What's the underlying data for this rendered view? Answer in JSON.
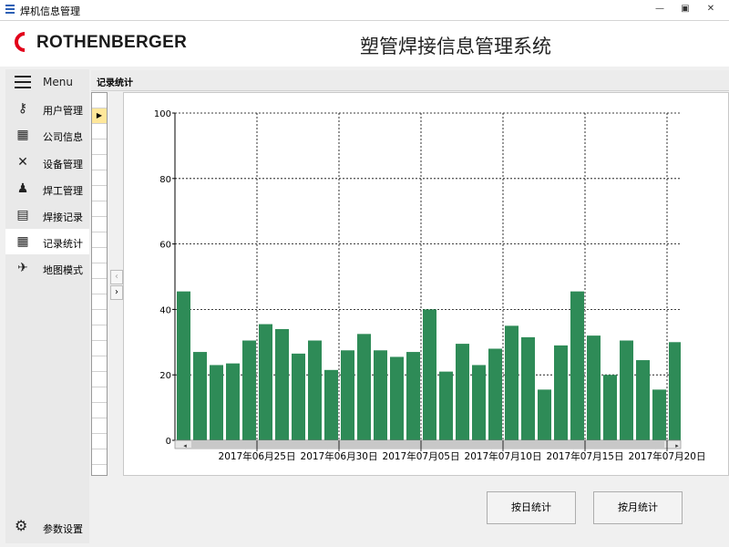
{
  "window": {
    "title": "焊机信息管理"
  },
  "header": {
    "logo_text": "ROTHENBERGER",
    "app_title": "塑管焊接信息管理系统"
  },
  "sidebar": {
    "menu_label": "Menu",
    "items": [
      {
        "label": "用户管理",
        "icon": "key-icon"
      },
      {
        "label": "公司信息",
        "icon": "building-icon"
      },
      {
        "label": "设备管理",
        "icon": "tools-icon"
      },
      {
        "label": "焊工管理",
        "icon": "person-icon"
      },
      {
        "label": "焊接记录",
        "icon": "document-icon"
      },
      {
        "label": "记录统计",
        "icon": "table-icon",
        "active": true
      },
      {
        "label": "地图模式",
        "icon": "plane-icon"
      }
    ],
    "settings_label": "参数设置"
  },
  "panel": {
    "tab_label": "记录统计"
  },
  "buttons": {
    "daily": "按日统计",
    "monthly": "按月统计"
  },
  "colors": {
    "bar": "#2e8b57",
    "logo_red": "#e2001a"
  },
  "chart_data": {
    "type": "bar",
    "title": "",
    "xlabel": "",
    "ylabel": "",
    "ylim": [
      0,
      100
    ],
    "yticks": [
      0,
      20,
      40,
      60,
      80,
      100
    ],
    "grid": true,
    "x_tick_labels": [
      "2017年06月25日",
      "2017年06月30日",
      "2017年07月05日",
      "2017年07月10日",
      "2017年07月15日",
      "2017年07月20日"
    ],
    "categories": [
      "2017-06-21",
      "2017-06-22",
      "2017-06-23",
      "2017-06-24",
      "2017-06-25",
      "2017-06-26",
      "2017-06-27",
      "2017-06-28",
      "2017-06-29",
      "2017-06-30",
      "2017-07-01",
      "2017-07-02",
      "2017-07-03",
      "2017-07-04",
      "2017-07-05",
      "2017-07-06",
      "2017-07-07",
      "2017-07-08",
      "2017-07-09",
      "2017-07-10",
      "2017-07-11",
      "2017-07-12",
      "2017-07-13",
      "2017-07-14",
      "2017-07-15",
      "2017-07-16",
      "2017-07-17",
      "2017-07-18",
      "2017-07-19",
      "2017-07-20",
      "2017-07-21"
    ],
    "values": [
      45.5,
      27,
      23,
      23.5,
      30.5,
      35.5,
      34,
      26.5,
      30.5,
      21.5,
      27.5,
      32.5,
      27.5,
      25.5,
      27,
      40,
      21,
      29.5,
      23,
      28,
      35,
      31.5,
      15.5,
      29,
      45.5,
      32,
      20,
      30.5,
      24.5,
      15.5,
      30
    ]
  }
}
